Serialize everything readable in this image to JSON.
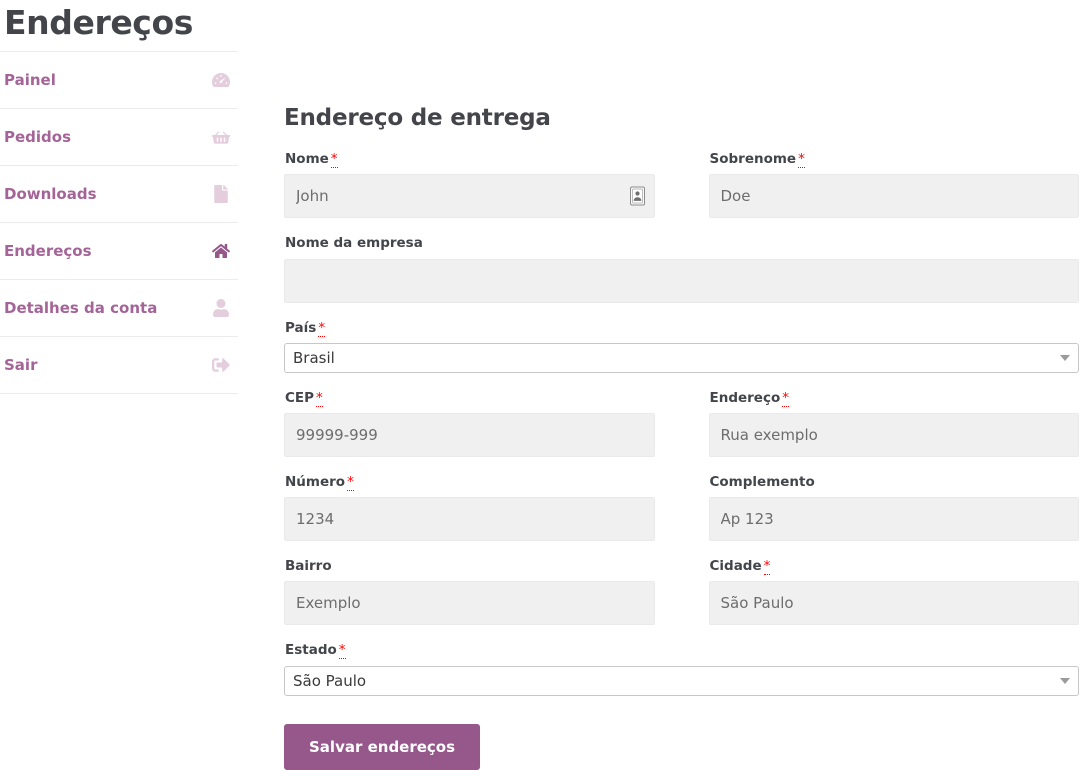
{
  "page": {
    "title": "Endereços",
    "accent_color": "#96588a",
    "link_color": "#a46497",
    "heading_color": "#43454b",
    "required_color": "#ff0000",
    "input_bg": "#f0f0f0"
  },
  "sidebar": {
    "items": [
      {
        "label": "Painel",
        "icon": "tachometer-icon",
        "active": false
      },
      {
        "label": "Pedidos",
        "icon": "shopping-basket-icon",
        "active": false
      },
      {
        "label": "Downloads",
        "icon": "file-download-icon",
        "active": false
      },
      {
        "label": "Endereços",
        "icon": "home-icon",
        "active": true
      },
      {
        "label": "Detalhes da conta",
        "icon": "user-icon",
        "active": false
      },
      {
        "label": "Sair",
        "icon": "sign-out-icon",
        "active": false
      }
    ]
  },
  "form": {
    "heading": "Endereço de entrega",
    "required_mark": "*",
    "fields": {
      "first_name": {
        "label": "Nome",
        "required": true,
        "value": "",
        "placeholder": "John",
        "type": "text",
        "icon": "contact-card-icon"
      },
      "last_name": {
        "label": "Sobrenome",
        "required": true,
        "value": "",
        "placeholder": "Doe",
        "type": "text"
      },
      "company": {
        "label": "Nome da empresa",
        "required": false,
        "value": "",
        "placeholder": "",
        "type": "text"
      },
      "country": {
        "label": "País",
        "required": true,
        "value": "Brasil",
        "type": "select"
      },
      "postcode": {
        "label": "CEP",
        "required": true,
        "value": "",
        "placeholder": "99999-999",
        "type": "text"
      },
      "address": {
        "label": "Endereço",
        "required": true,
        "value": "",
        "placeholder": "Rua exemplo",
        "type": "text"
      },
      "number": {
        "label": "Número",
        "required": true,
        "value": "",
        "placeholder": "1234",
        "type": "text"
      },
      "complement": {
        "label": "Complemento",
        "required": false,
        "value": "",
        "placeholder": "Ap 123",
        "type": "text"
      },
      "district": {
        "label": "Bairro",
        "required": false,
        "value": "",
        "placeholder": "Exemplo",
        "type": "text"
      },
      "city": {
        "label": "Cidade",
        "required": true,
        "value": "",
        "placeholder": "São Paulo",
        "type": "text"
      },
      "state": {
        "label": "Estado",
        "required": true,
        "value": "São Paulo",
        "type": "select"
      }
    },
    "submit_label": "Salvar endereços"
  }
}
